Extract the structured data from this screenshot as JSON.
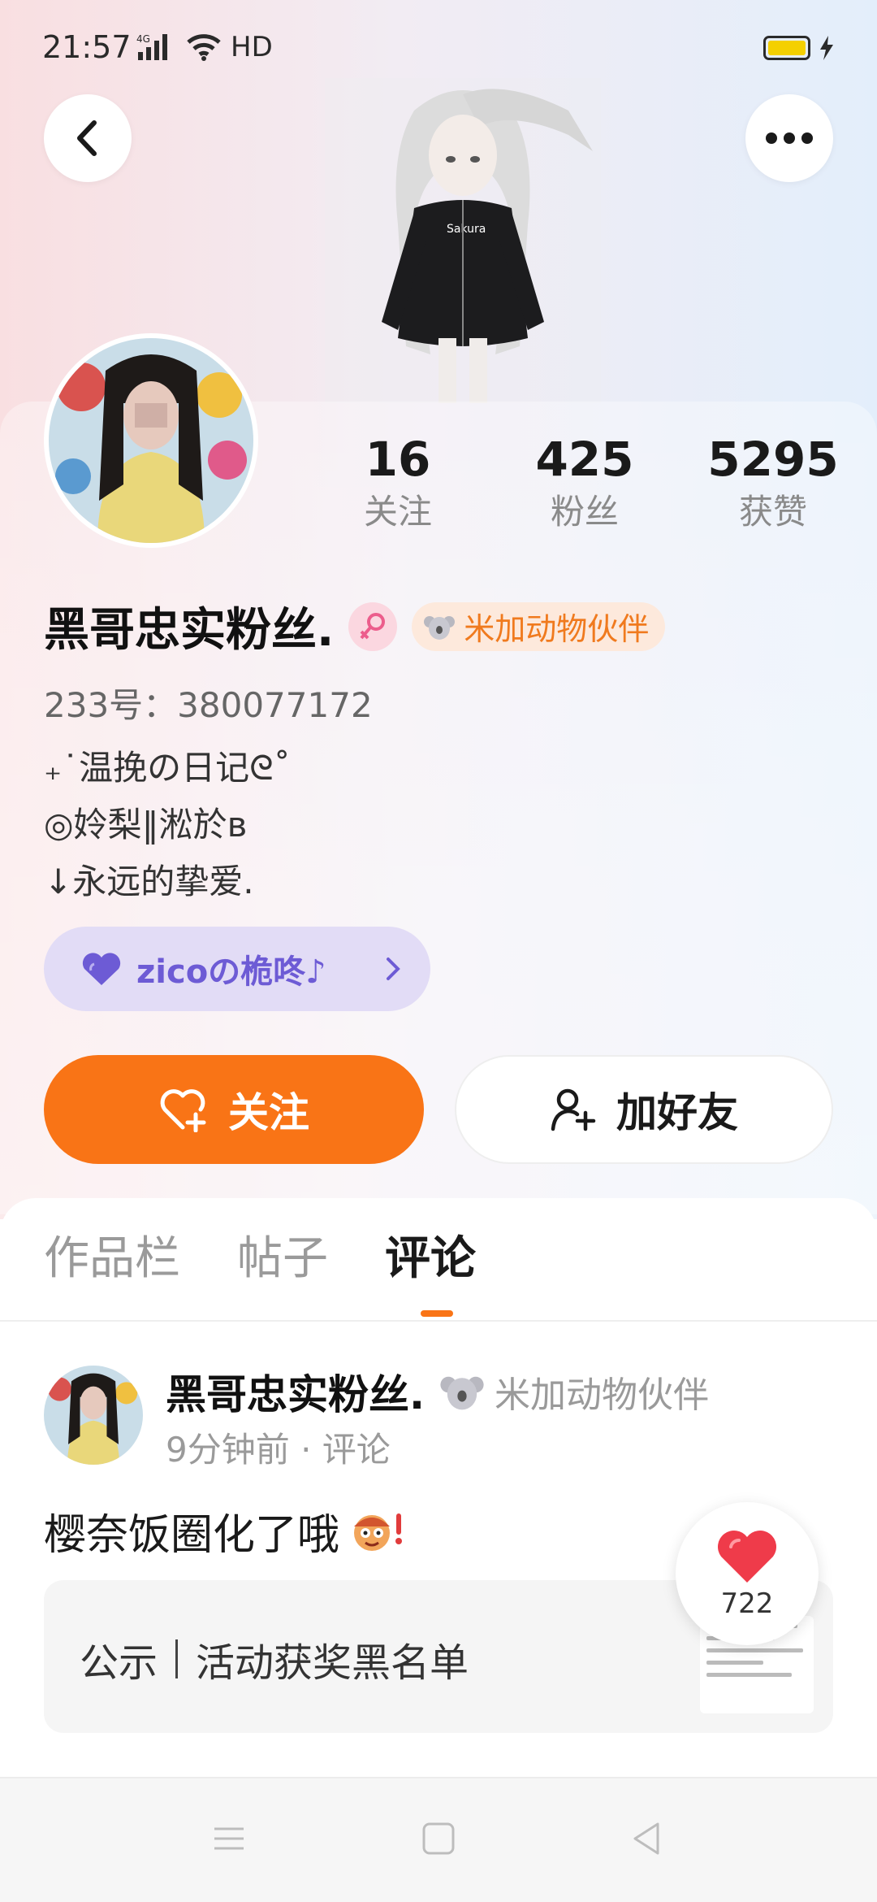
{
  "status_bar": {
    "time": "21:57",
    "network": "4G",
    "hd": "HD",
    "battery_color": "#f4d000"
  },
  "header": {
    "back_icon": "chevron-left-icon",
    "more_icon": "more-dots-icon"
  },
  "profile": {
    "stats": [
      {
        "value": "16",
        "label": "关注"
      },
      {
        "value": "425",
        "label": "粉丝"
      },
      {
        "value": "5295",
        "label": "获赞"
      }
    ],
    "username": "黑哥忠实粉丝.",
    "gender_icon": "female-icon",
    "badge": "米加动物伙伴",
    "uid": "233号：380077172",
    "bio": [
      "₊˙温挽の日记ᘓ˚",
      "◎姈梨‖淞於ʙ",
      "↓永远的挚爱."
    ],
    "club": "zicoの桅咚♪"
  },
  "actions": {
    "follow": "关注",
    "add_friend": "加好友"
  },
  "tabs": [
    {
      "label": "作品栏",
      "active": false
    },
    {
      "label": "帖子",
      "active": false
    },
    {
      "label": "评论",
      "active": true
    }
  ],
  "accent_color": "#f97416",
  "post": {
    "author": "黑哥忠实粉丝.",
    "badge": "米加动物伙伴",
    "meta": "9分钟前 · 评论",
    "text": "樱奈饭圈化了哦",
    "quote": {
      "tag": "公示",
      "title": "活动获奖黑名单"
    },
    "likes": "722"
  }
}
